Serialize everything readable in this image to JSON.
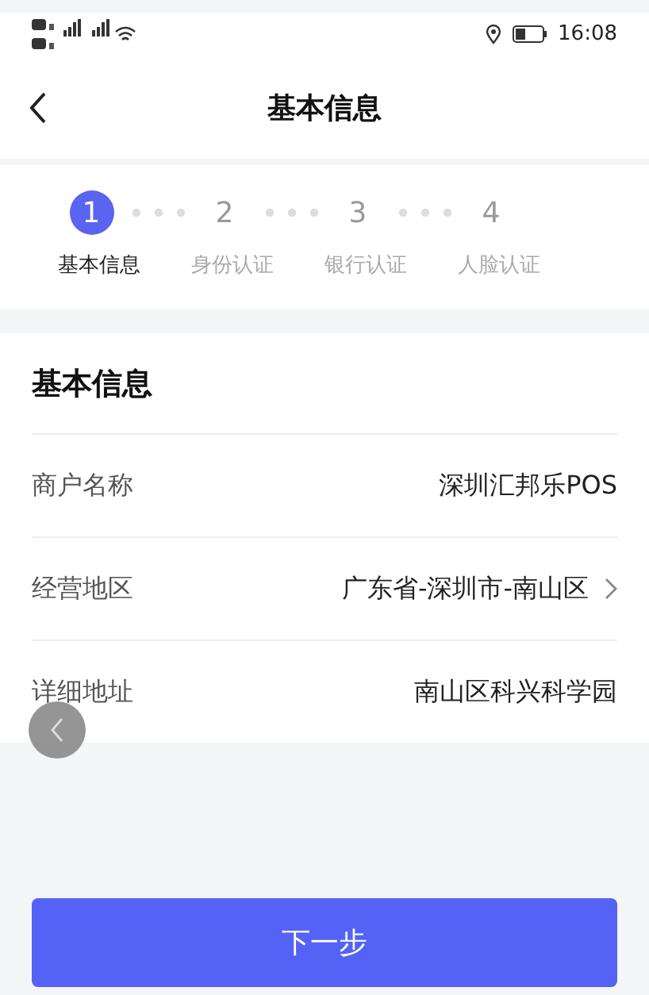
{
  "status_bar": {
    "time": "16:08"
  },
  "header": {
    "title": "基本信息"
  },
  "steps": [
    {
      "number": "1",
      "label": "基本信息",
      "selected": true
    },
    {
      "number": "2",
      "label": "身份认证",
      "selected": false
    },
    {
      "number": "3",
      "label": "银行认证",
      "selected": false
    },
    {
      "number": "4",
      "label": "人脸认证",
      "selected": false
    }
  ],
  "section": {
    "title": "基本信息"
  },
  "fields": [
    {
      "label": "商户名称",
      "value": "深圳汇邦乐POS",
      "kind": "text"
    },
    {
      "label": "经营地区",
      "value": "广东省-深圳市-南山区",
      "kind": "select"
    },
    {
      "label": "详细地址",
      "value": "南山区科兴科学园",
      "kind": "text"
    }
  ],
  "next_button": "下一步"
}
